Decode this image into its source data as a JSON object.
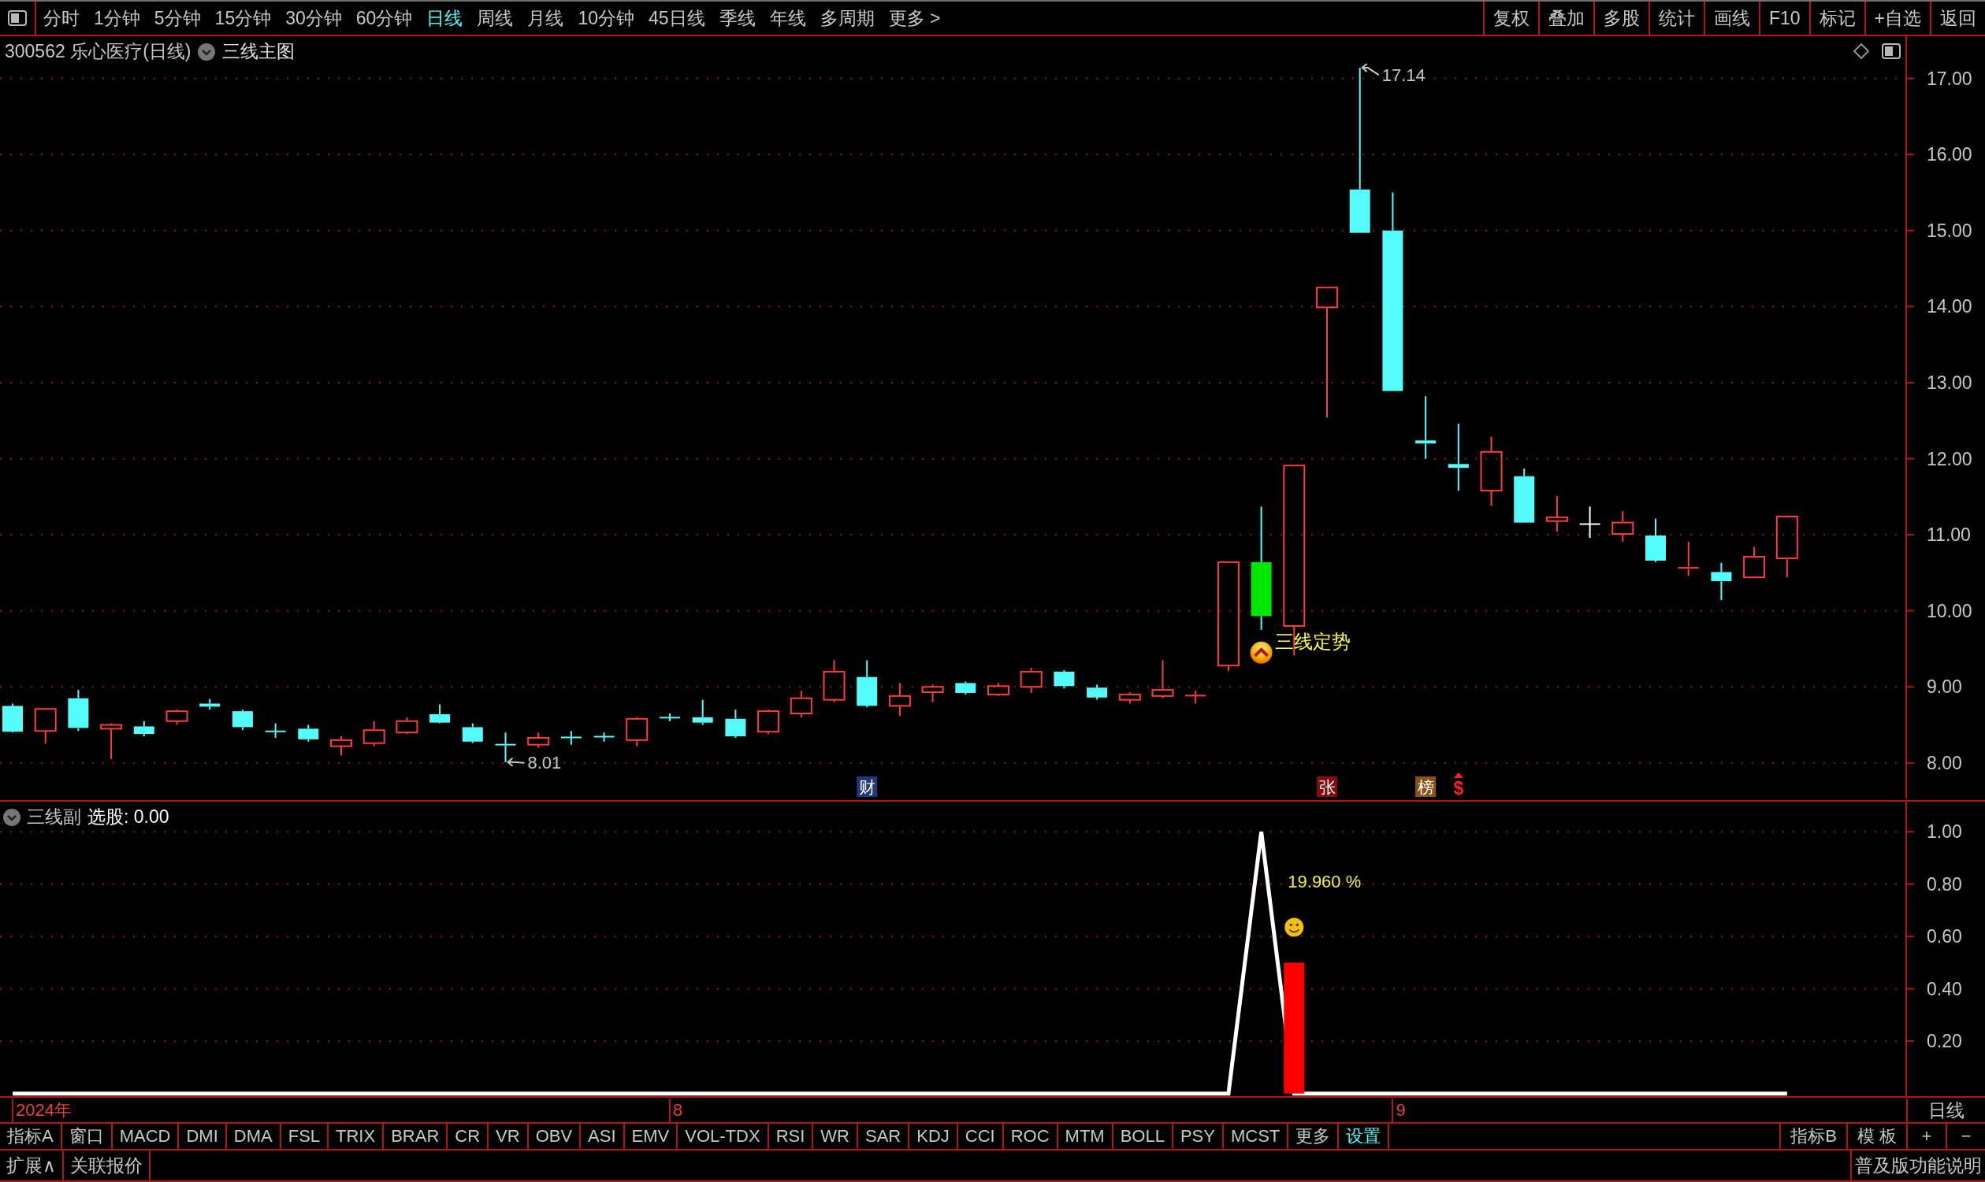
{
  "toolbar": {
    "periods": [
      {
        "label": "分时",
        "selected": false
      },
      {
        "label": "1分钟",
        "selected": false
      },
      {
        "label": "5分钟",
        "selected": false
      },
      {
        "label": "15分钟",
        "selected": false
      },
      {
        "label": "30分钟",
        "selected": false
      },
      {
        "label": "60分钟",
        "selected": false
      },
      {
        "label": "日线",
        "selected": true
      },
      {
        "label": "周线",
        "selected": false
      },
      {
        "label": "月线",
        "selected": false
      },
      {
        "label": "10分钟",
        "selected": false
      },
      {
        "label": "45日线",
        "selected": false
      },
      {
        "label": "季线",
        "selected": false
      },
      {
        "label": "年线",
        "selected": false
      },
      {
        "label": "多周期",
        "selected": false
      },
      {
        "label": "更多 >",
        "selected": false
      }
    ],
    "actions": [
      "复权",
      "叠加",
      "多股",
      "统计",
      "画线",
      "F10",
      "标记",
      "+自选",
      "返回"
    ]
  },
  "main_chart": {
    "title": "300562 乐心医疗(日线)",
    "template": "三线主图",
    "price_axis": [
      "17.00",
      "16.00",
      "15.00",
      "14.00",
      "13.00",
      "12.00",
      "11.00",
      "10.00",
      "9.00",
      "8.00"
    ],
    "high_label": "17.14",
    "low_label": "8.01",
    "signal_label": "三线定势",
    "event_markers": [
      {
        "kind": "badge",
        "text": "财",
        "color": "#22367e"
      },
      {
        "kind": "badge",
        "text": "张",
        "color": "#840c0c"
      },
      {
        "kind": "badge",
        "text": "榜",
        "color": "#8a5216"
      },
      {
        "kind": "sign",
        "text": "$",
        "color": "#ff2020"
      }
    ]
  },
  "sub_chart": {
    "name": "三线副",
    "reading": "选股: 0.00",
    "chart_data": {
      "type": "line",
      "ylim": [
        -0.013,
        1.118
      ],
      "yticks": [
        {
          "value": 0.2,
          "label": "0.20"
        },
        {
          "value": 0.4,
          "label": "0.40"
        },
        {
          "value": 0.6,
          "label": "0.60"
        },
        {
          "value": 0.8,
          "label": "0.80"
        },
        {
          "value": 1.0,
          "label": "1.00"
        }
      ],
      "grid": true,
      "series": [
        {
          "color": "#ffffff",
          "values": [
            0,
            0,
            0,
            0,
            0,
            0,
            0,
            0,
            0,
            0,
            0,
            0,
            0,
            0,
            0,
            0,
            0,
            0,
            0,
            0,
            0,
            0,
            0,
            0,
            0,
            0,
            0,
            0,
            0,
            0,
            0,
            0,
            0,
            0,
            0,
            0,
            0,
            0,
            1,
            0,
            0,
            0,
            0,
            0,
            0,
            0,
            0,
            0,
            0,
            0,
            0,
            0,
            0,
            0,
            0
          ]
        }
      ],
      "annotations": [
        "19.960 %"
      ]
    }
  },
  "date_axis": {
    "labels": [
      "2024年",
      "8",
      "9"
    ],
    "period": "日线"
  },
  "indicator_bar": {
    "tabs": [
      {
        "label": "指标A",
        "selected": false
      },
      {
        "label": "窗口",
        "selected": false
      },
      {
        "label": "MACD",
        "selected": false
      },
      {
        "label": "DMI",
        "selected": false
      },
      {
        "label": "DMA",
        "selected": false
      },
      {
        "label": "FSL",
        "selected": false
      },
      {
        "label": "TRIX",
        "selected": false
      },
      {
        "label": "BRAR",
        "selected": false
      },
      {
        "label": "CR",
        "selected": false
      },
      {
        "label": "VR",
        "selected": false
      },
      {
        "label": "OBV",
        "selected": false
      },
      {
        "label": "ASI",
        "selected": false
      },
      {
        "label": "EMV",
        "selected": false
      },
      {
        "label": "VOL-TDX",
        "selected": false
      },
      {
        "label": "RSI",
        "selected": false
      },
      {
        "label": "WR",
        "selected": false
      },
      {
        "label": "SAR",
        "selected": false
      },
      {
        "label": "KDJ",
        "selected": false
      },
      {
        "label": "CCI",
        "selected": false
      },
      {
        "label": "ROC",
        "selected": false
      },
      {
        "label": "MTM",
        "selected": false
      },
      {
        "label": "BOLL",
        "selected": false
      },
      {
        "label": "PSY",
        "selected": false
      },
      {
        "label": "MCST",
        "selected": false
      },
      {
        "label": "更多",
        "selected": false
      },
      {
        "label": "设置",
        "selected": true
      }
    ],
    "tools": [
      "指标B",
      "模 板",
      "+",
      "−"
    ]
  },
  "footer": {
    "buttons": [
      "扩展∧",
      "关联报价"
    ],
    "help": "普及版功能说明"
  }
}
